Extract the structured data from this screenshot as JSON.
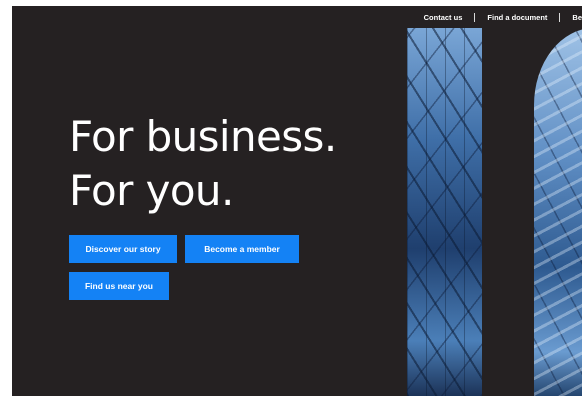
{
  "topnav": {
    "items": [
      "Contact us",
      "Find a document",
      "Be"
    ]
  },
  "hero": {
    "title_line1": "For business.",
    "title_line2": "For you."
  },
  "buttons": {
    "story": "Discover our story",
    "member": "Become a member",
    "near": "Find us near you"
  },
  "colors": {
    "background": "#252122",
    "accent": "#1482f5",
    "text": "#ffffff"
  }
}
